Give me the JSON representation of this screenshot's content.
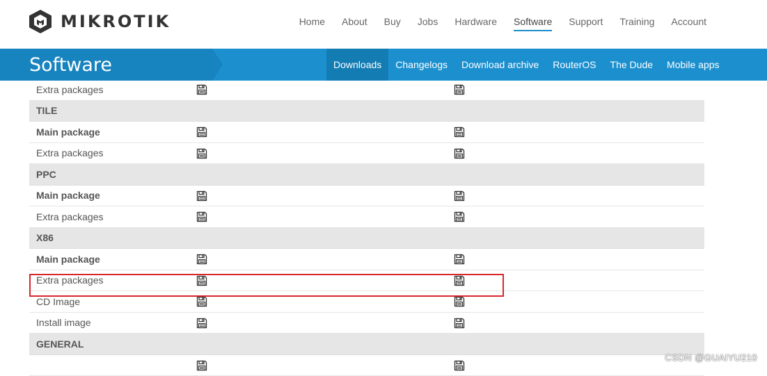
{
  "brand": {
    "name": "MIKROTIK"
  },
  "topnav": {
    "items": [
      {
        "label": "Home",
        "active": false
      },
      {
        "label": "About",
        "active": false
      },
      {
        "label": "Buy",
        "active": false
      },
      {
        "label": "Jobs",
        "active": false
      },
      {
        "label": "Hardware",
        "active": false
      },
      {
        "label": "Software",
        "active": true
      },
      {
        "label": "Support",
        "active": false
      },
      {
        "label": "Training",
        "active": false
      },
      {
        "label": "Account",
        "active": false
      }
    ]
  },
  "band": {
    "title": "Software",
    "subnav": [
      {
        "label": "Downloads",
        "active": true
      },
      {
        "label": "Changelogs",
        "active": false
      },
      {
        "label": "Download archive",
        "active": false
      },
      {
        "label": "RouterOS",
        "active": false
      },
      {
        "label": "The Dude",
        "active": false
      },
      {
        "label": "Mobile apps",
        "active": false
      }
    ]
  },
  "table": {
    "rows": [
      {
        "type": "package",
        "label": "Extra packages",
        "downloads": 2
      },
      {
        "type": "header",
        "label": "TILE"
      },
      {
        "type": "main",
        "label": "Main package",
        "downloads": 2
      },
      {
        "type": "package",
        "label": "Extra packages",
        "downloads": 2
      },
      {
        "type": "header",
        "label": "PPC"
      },
      {
        "type": "main",
        "label": "Main package",
        "downloads": 2
      },
      {
        "type": "package",
        "label": "Extra packages",
        "downloads": 2
      },
      {
        "type": "header",
        "label": "X86"
      },
      {
        "type": "main",
        "label": "Main package",
        "downloads": 2
      },
      {
        "type": "package",
        "label": "Extra packages",
        "downloads": 2
      },
      {
        "type": "package",
        "label": "CD Image",
        "downloads": 2
      },
      {
        "type": "package",
        "label": "Install image",
        "downloads": 2
      },
      {
        "type": "header",
        "label": "GENERAL"
      },
      {
        "type": "package",
        "label": "",
        "downloads": 2
      }
    ],
    "download_icon": "floppy-disk-icon"
  },
  "colors": {
    "band": "#1c90cf",
    "band_left": "#1783bf",
    "subnav_active": "#137cb3",
    "highlight": "#d9262b"
  },
  "watermark": "CSDN @GUAIYU210"
}
